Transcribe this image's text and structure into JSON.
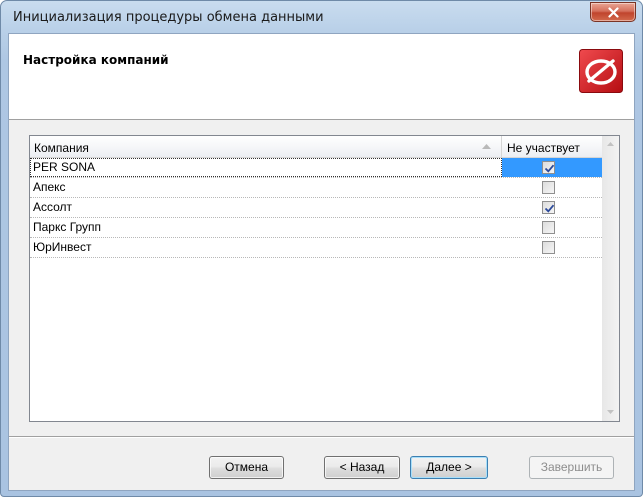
{
  "window": {
    "title": "Инициализация процедуры обмена данными"
  },
  "header": {
    "title": "Настройка компаний",
    "logo_icon": "persona-logo-icon"
  },
  "grid": {
    "columns": {
      "company": "Компания",
      "excluded": "Не участвует"
    },
    "rows": [
      {
        "name": "PER SONA",
        "excluded": true,
        "selected": true
      },
      {
        "name": "Апекс",
        "excluded": false,
        "selected": false
      },
      {
        "name": "Ассолт",
        "excluded": true,
        "selected": false
      },
      {
        "name": "Паркс Групп",
        "excluded": false,
        "selected": false
      },
      {
        "name": "ЮрИнвест",
        "excluded": false,
        "selected": false
      }
    ]
  },
  "buttons": {
    "cancel": "Отмена",
    "back": "< Назад",
    "next": "Далее >",
    "finish": "Завершить"
  },
  "colors": {
    "selection": "#3399ff",
    "accent_red": "#d8161c"
  }
}
